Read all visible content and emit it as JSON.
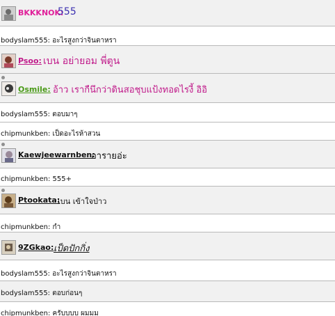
{
  "posts": [
    {
      "user": "BKKKNOK",
      "message": "555",
      "user_color": "#e0209a",
      "msg_color": "#3b2fb0"
    },
    {
      "user": "Psoo",
      "message": "เบน อย่ายอม พี่ตูน",
      "user_color": "#c01a8a",
      "msg_color": "#c01a8a"
    },
    {
      "user": "Osmile",
      "message": "อ้าว เรากืนึกว่าดินสอชุบแป้งทอดไรงี้ อิอิ",
      "user_color": "#4a9a18",
      "msg_color": "#c01a8a"
    },
    {
      "user": "Kaewjeewarnben",
      "message": "อารายอ่ะ",
      "user_color": "#111111",
      "msg_color": "#111111"
    },
    {
      "user": "Ptookata",
      "message": "เบน เข้าใจป่าว",
      "user_color": "#111111",
      "msg_color": "#111111"
    },
    {
      "user": "9ZGkao",
      "message": "เป็ดปักกิ่ง",
      "user_color": "#111111",
      "msg_color": "#111111"
    }
  ],
  "chat": [
    "bodyslam555: อะไรสูงกว่าจินตาหรา",
    "bodyslam555: ตอบมาๆ",
    "chipmunkben: เป็ดอะไรห้าสวน",
    "chipmunkben: 555+",
    "chipmunkben: กำ",
    "bodyslam555: อะไรสูงกว่าจินตาหรา",
    "bodyslam555: ตอบก่อนๆ",
    "chipmunkben: ครับบบบ ผมมม"
  ],
  "colon": ":"
}
